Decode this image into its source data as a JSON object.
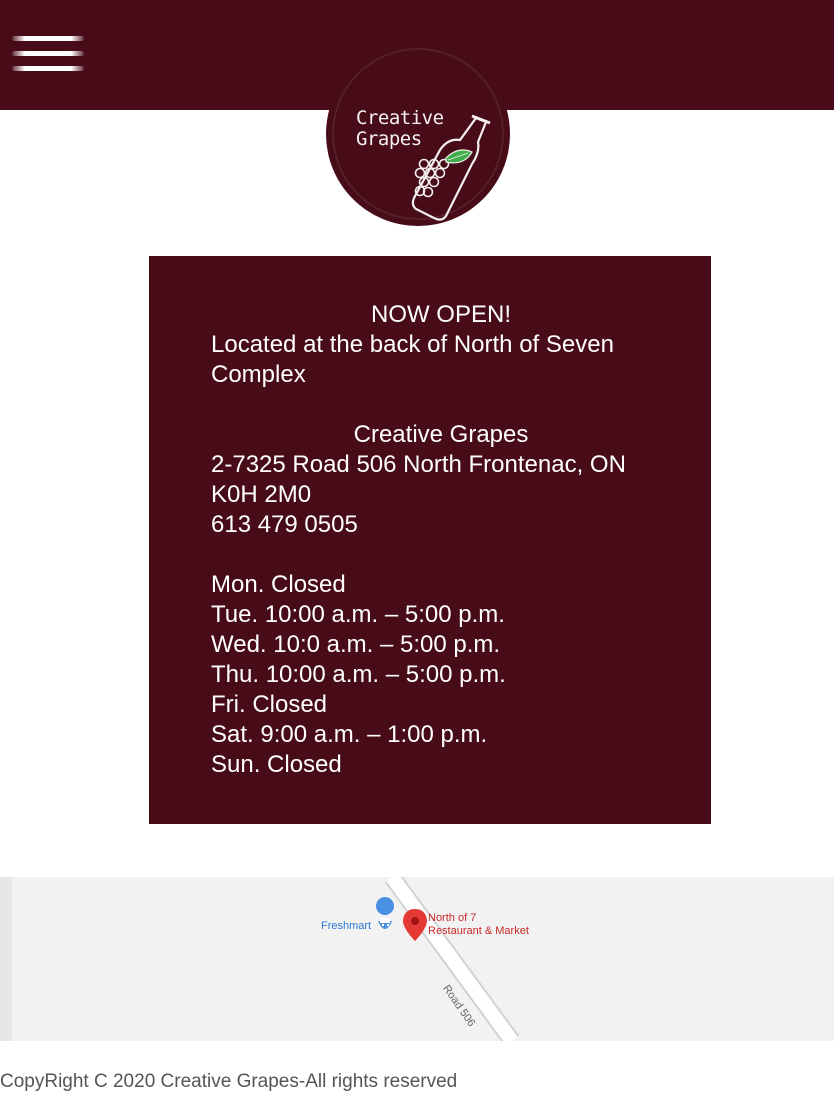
{
  "header": {
    "menu_icon": "hamburger-menu-icon",
    "bg_color": "#470c18"
  },
  "logo": {
    "line1": "Creative",
    "line2": "Grapes",
    "icon": "wine-bottle-grapes-icon"
  },
  "info": {
    "headline": "NOW OPEN!",
    "location_note": "Located at the back of North of Seven Complex",
    "business_name": "Creative Grapes",
    "address": "2-7325 Road 506 North Frontenac, ON K0H 2M0",
    "phone": "613 479 0505",
    "hours": [
      "Mon. Closed",
      "Tue. 10:00 a.m. – 5:00 p.m.",
      "Wed. 10:0 a.m. – 5:00 p.m.",
      "Thu. 10:00 a.m. – 5:00 p.m.",
      "Fri. Closed",
      "Sat. 9:00 a.m. – 1:00 p.m.",
      "Sun. Closed"
    ]
  },
  "map": {
    "store_label": "Freshmart",
    "store_icon": "shopping-cart-pin-icon",
    "marker_icon": "location-pin-icon",
    "marker_label_1": "North of 7",
    "marker_label_2": "Restaurant & Market",
    "road_label": "Road 506"
  },
  "footer": {
    "copyright": "CopyRight C 2020 Creative Grapes-All rights reserved"
  }
}
